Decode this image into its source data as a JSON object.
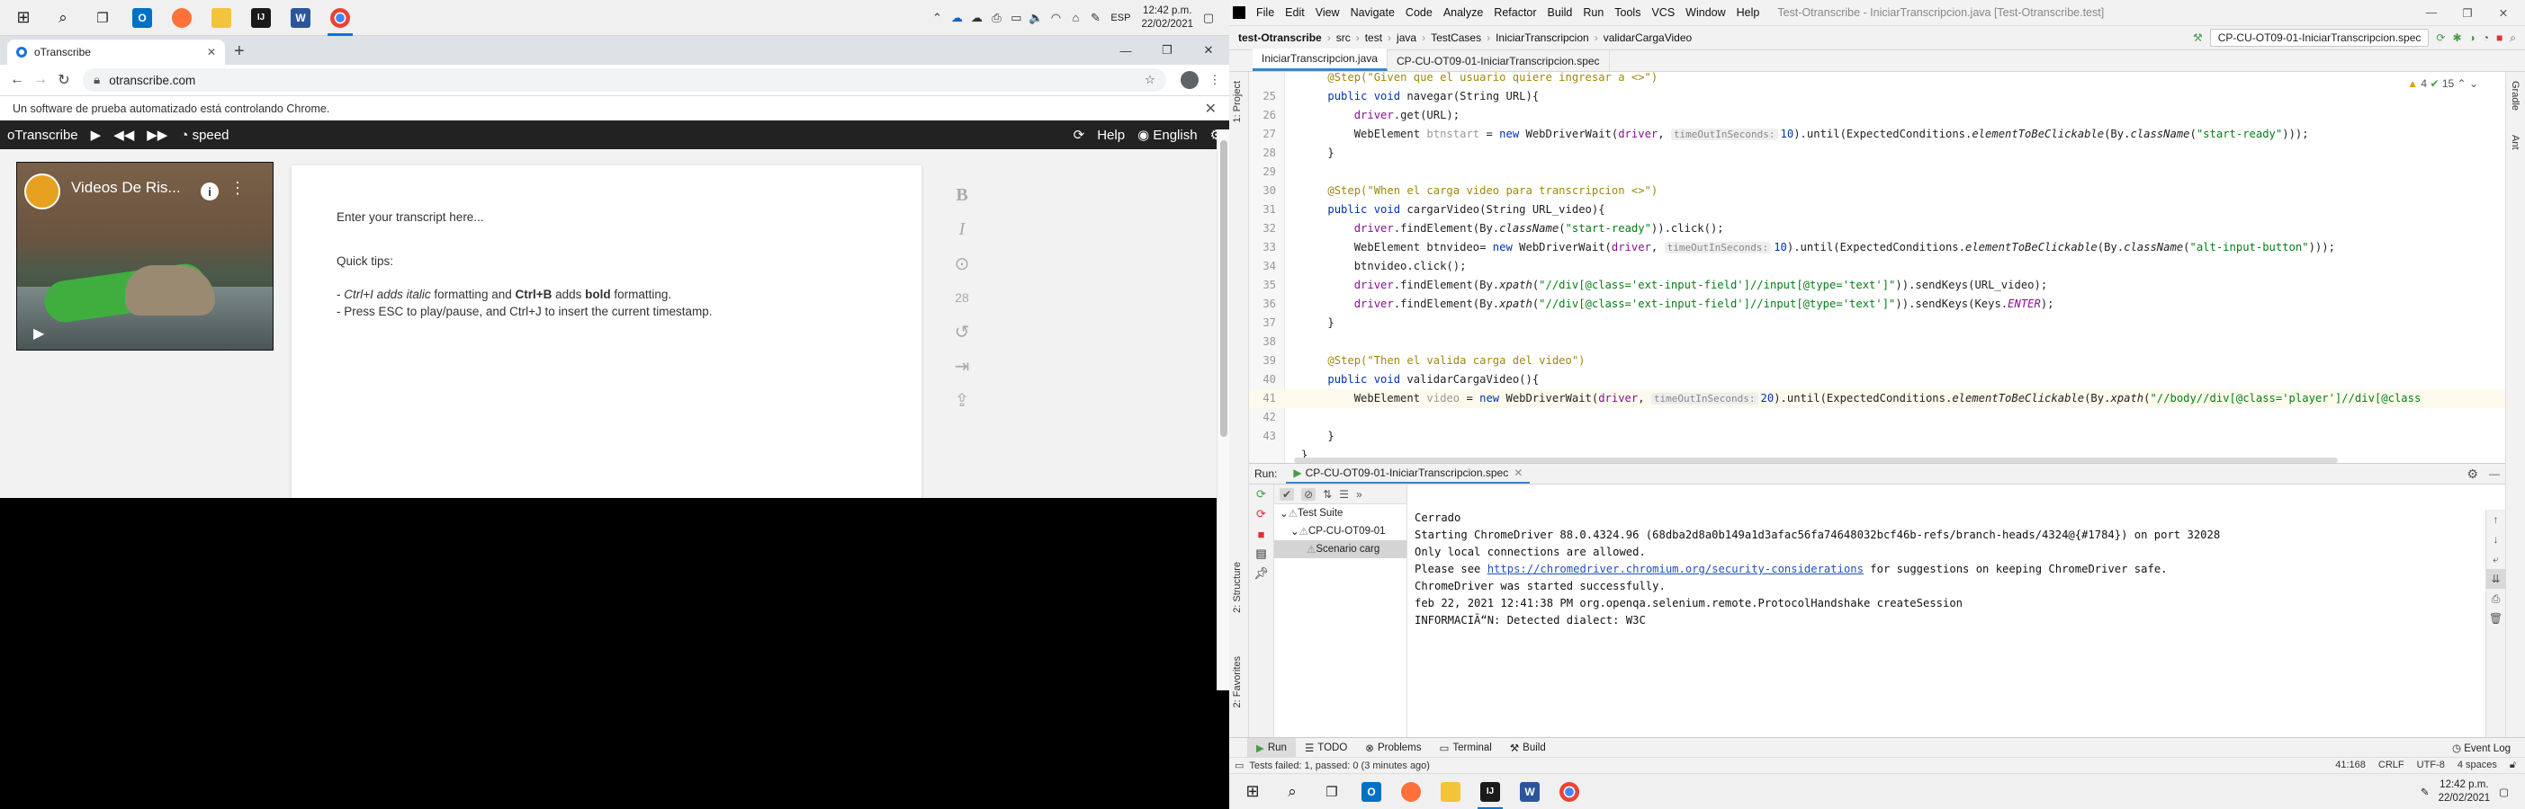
{
  "left_taskbar": {
    "apps": [
      {
        "name": "windows-start",
        "glyph": "⊞"
      },
      {
        "name": "search",
        "glyph": "⌕"
      },
      {
        "name": "task-view",
        "glyph": "❐"
      },
      {
        "name": "outlook",
        "glyph": "O"
      },
      {
        "name": "firefox",
        "glyph": "●"
      },
      {
        "name": "file-explorer",
        "glyph": "▬"
      },
      {
        "name": "intellij",
        "glyph": "IJ"
      },
      {
        "name": "word",
        "glyph": "W"
      },
      {
        "name": "chrome",
        "glyph": "◉"
      }
    ],
    "lang": "ESP",
    "time": "12:42 p.m.",
    "date": "22/02/2021"
  },
  "chrome": {
    "tab_title": "oTranscribe",
    "url": "otranscribe.com",
    "automation_notice": "Un software de prueba automatizado está controlando Chrome."
  },
  "otranscribe": {
    "brand": "oTranscribe",
    "speed_label": "speed",
    "help_label": "Help",
    "language_label": "English",
    "video_title": "Videos De Ris...",
    "placeholder": "Enter your transcript here...",
    "tips_title": "Quick tips:",
    "tip1_a": "- ",
    "tip1_ctrl_i": "Ctrl+I adds italic",
    "tip1_b": " formatting and ",
    "tip1_ctrl_b": "Ctrl+B",
    "tip1_c": " adds ",
    "tip1_bold": "bold",
    "tip1_d": " formatting.",
    "tip2": "- Press ESC to play/pause, and Ctrl+J to insert the current timestamp.",
    "format_tools": [
      "B",
      "I",
      "⊙",
      "28",
      "↺",
      "⇥",
      "⇪"
    ]
  },
  "intellij": {
    "menu": [
      "File",
      "Edit",
      "View",
      "Navigate",
      "Code",
      "Analyze",
      "Refactor",
      "Build",
      "Run",
      "Tools",
      "VCS",
      "Window",
      "Help"
    ],
    "window_title": "Test-Otranscribe - IniciarTranscripcion.java [Test-Otranscribe.test]",
    "breadcrumbs": [
      "test-Otranscribe",
      "src",
      "test",
      "java",
      "TestCases",
      "IniciarTranscripcion",
      "validarCargaVideo"
    ],
    "run_config": "CP-CU-OT09-01-IniciarTranscripcion.spec",
    "tabs": [
      "IniciarTranscripcion.java",
      "CP-CU-OT09-01-IniciarTranscripcion.spec"
    ],
    "inspection": {
      "warnings": "4",
      "ok": "15"
    },
    "code_lines": [
      {
        "no": "",
        "html": "    <span class='an'>@Step(\"Given que el usuario quiere ingresar a <>\")</span>"
      },
      {
        "no": "25",
        "html": "    <span class='kw'>public void</span> navegar(String URL){"
      },
      {
        "no": "26",
        "html": "        <span class='fl'>driver</span>.get(URL);"
      },
      {
        "no": "27",
        "html": "        WebElement <span class='gray'>btnstart</span> = <span class='kw'>new</span> WebDriverWait(<span class='fl'>driver</span>, <span class='hint'>timeOutInSeconds:</span><span class='kw'>10</span>).until(ExpectedConditions.<span class='it'>elementToBeClickable</span>(By.<span class='it'>className</span>(<span class='st'>\"start-ready\"</span>)));"
      },
      {
        "no": "28",
        "html": "    }"
      },
      {
        "no": "29",
        "html": ""
      },
      {
        "no": "30",
        "html": "    <span class='an'>@Step(\"When el carga video para transcripcion <>\")</span>"
      },
      {
        "no": "31",
        "html": "    <span class='kw'>public void</span> cargarVideo(String URL_video){"
      },
      {
        "no": "32",
        "html": "        <span class='fl'>driver</span>.findElement(By.<span class='it'>className</span>(<span class='st'>\"start-ready\"</span>)).click();"
      },
      {
        "no": "33",
        "html": "        WebElement btnvideo= <span class='kw'>new</span> WebDriverWait(<span class='fl'>driver</span>, <span class='hint'>timeOutInSeconds:</span><span class='kw'>10</span>).until(ExpectedConditions.<span class='it'>elementToBeClickable</span>(By.<span class='it'>className</span>(<span class='st'>\"alt-input-button\"</span>)));"
      },
      {
        "no": "34",
        "html": "        btnvideo.click();"
      },
      {
        "no": "35",
        "html": "        <span class='fl'>driver</span>.findElement(By.<span class='it'>xpath</span>(<span class='st'>\"//div[@class='ext-input-field']//input[@type='text']\"</span>)).sendKeys(URL_video);"
      },
      {
        "no": "36",
        "html": "        <span class='fl'>driver</span>.findElement(By.<span class='it'>xpath</span>(<span class='st'>\"//div[@class='ext-input-field']//input[@type='text']\"</span>)).sendKeys(Keys.<span class='fl it'>ENTER</span>);"
      },
      {
        "no": "37",
        "html": "    }"
      },
      {
        "no": "38",
        "html": ""
      },
      {
        "no": "39",
        "html": "    <span class='an'>@Step(\"Then el valida carga del video\")</span>"
      },
      {
        "no": "40",
        "html": "    <span class='kw'>public void</span> validarCargaVideo(){"
      },
      {
        "no": "41",
        "html": "        WebElement <span class='gray'>video</span> = <span class='kw'>new</span> WebDriverWait(<span class='fl'>driver</span>, <span class='hint'>timeOutInSeconds:</span><span class='kw'>20</span>).until(ExpectedConditions.<span class='it'>elementToBeClickable</span>(By.<span class='it'>xpath</span>(<span class='st'>\"//body//div[@class='player']//div[@class</span>"
      },
      {
        "no": "42",
        "html": ""
      },
      {
        "no": "43",
        "html": "    }"
      },
      {
        "no": "",
        "html": "}"
      }
    ],
    "run": {
      "label": "Run:",
      "config": "CP-CU-OT09-01-IniciarTranscripcion.spec",
      "tree": [
        "Test Suite",
        "CP-CU-OT09-01",
        "Scenario carg"
      ],
      "console": [
        "Cerrado",
        "Starting ChromeDriver 88.0.4324.96 (68dba2d8a0b149a1d3afac56fa74648032bcf46b-refs/branch-heads/4324@{#1784}) on port 32028",
        "Only local connections are allowed.",
        "",
        "ChromeDriver was started successfully.",
        "feb 22, 2021 12:41:38 PM org.openqa.selenium.remote.ProtocolHandshake createSession",
        "INFORMACIÃ“N: Detected dialect: W3C"
      ],
      "please_see": "Please see ",
      "link": "https://chromedriver.chromium.org/security-considerations",
      "after_link": " for suggestions on keeping ChromeDriver safe."
    },
    "toolwindows": [
      "Run",
      "TODO",
      "Problems",
      "Terminal",
      "Build"
    ],
    "event_log": "Event Log",
    "status_left": "Tests failed: 1, passed: 0 (3 minutes ago)",
    "status_right": [
      "41:168",
      "CRLF",
      "UTF-8",
      "4 spaces"
    ],
    "side_left": [
      "1: Project",
      "2: Structure",
      "2: Favorites"
    ],
    "side_right": [
      "Gradle",
      "Ant"
    ]
  },
  "right_taskbar": {
    "time": "12:42 p.m.",
    "date": "22/02/2021"
  }
}
